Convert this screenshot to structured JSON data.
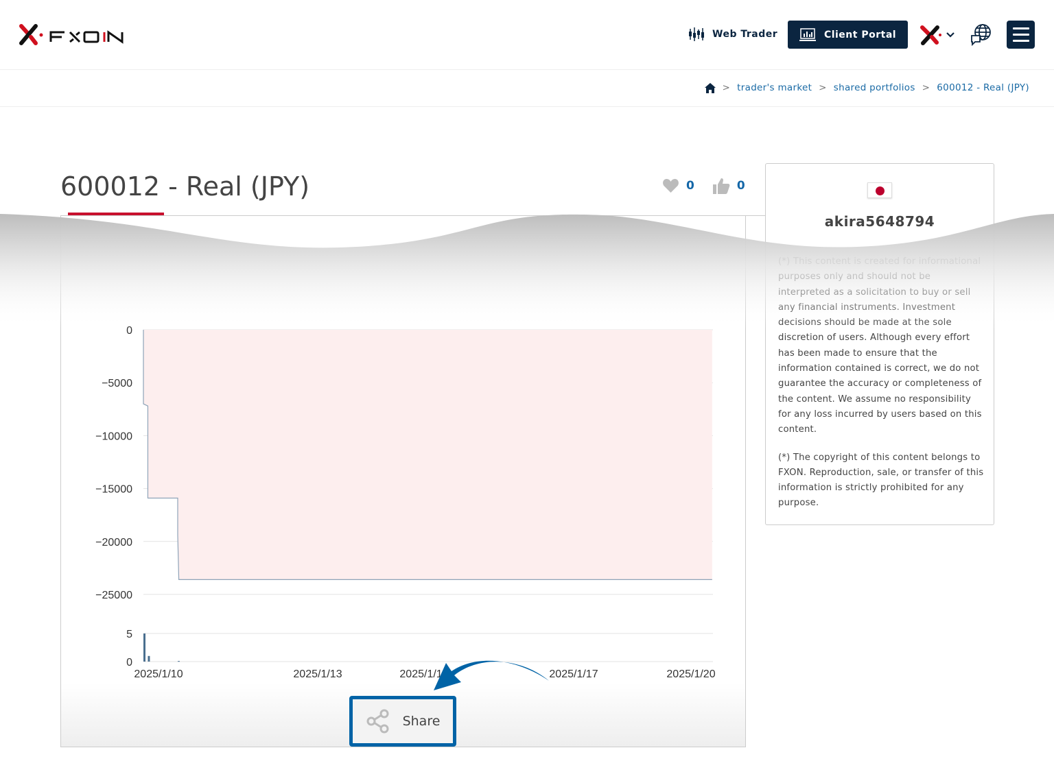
{
  "header": {
    "brand": "FXON",
    "web_trader": "Web Trader",
    "client_portal": "Client Portal",
    "menu_icon": "hamburger-icon",
    "language_icon": "globe-chat-icon"
  },
  "breadcrumb": {
    "home_icon": "home-icon",
    "separator": ">",
    "items": [
      "trader's market",
      "shared portfolios",
      "600012 - Real (JPY)"
    ]
  },
  "page": {
    "title": "600012 - Real (JPY)",
    "favorites": "0",
    "likes": "0"
  },
  "profile": {
    "country": "Japan",
    "username": "akira5648794",
    "disclaimer_1": "(*) This content is created for informational purposes only and should not be interpreted as a solicitation to buy or sell any financial instruments. Investment decisions should be made at the sole discretion of users. Although every effort has been made to ensure that the information contained is correct, we do not guarantee the accuracy or completeness of the content. We assume no responsibility for any loss incurred by users based on this content.",
    "disclaimer_2": "(*) The copyright of this content belongs to FXON. Reproduction, sale, or transfer of this information is strictly prohibited for any purpose."
  },
  "share": {
    "label": "Share",
    "icon": "share-icon"
  },
  "colors": {
    "navy": "#0b2540",
    "accent_red": "#c8102e",
    "link_blue": "#1a6aa5",
    "highlight_blue": "#0063a6",
    "area_fill": "#fdeeee",
    "line": "#8ea3b8"
  },
  "chart_data": {
    "type": "area",
    "x_tick_labels": [
      "2025/1/10",
      "2025/1/13",
      "2025/1/15",
      "2025/1/17",
      "2025/1/20"
    ],
    "y_ticks": [
      0,
      -5000,
      -10000,
      -15000,
      -20000,
      -25000
    ],
    "ylim": [
      -25000,
      0
    ],
    "grid": true,
    "series": [
      {
        "points": [
          {
            "x": "2025/1/10 00:00",
            "y": 0
          },
          {
            "x": "2025/1/10 00:00",
            "y": -7000
          },
          {
            "x": "2025/1/10 02:00",
            "y": -7200
          },
          {
            "x": "2025/1/10 02:00",
            "y": -15900
          },
          {
            "x": "2025/1/10 15:30",
            "y": -15900
          },
          {
            "x": "2025/1/10 15:30",
            "y": -19400
          },
          {
            "x": "2025/1/10 16:00",
            "y": -23600
          },
          {
            "x": "2025/1/20 17:00",
            "y": -23600
          }
        ]
      }
    ],
    "volume": {
      "y_ticks": [
        0,
        5
      ],
      "ylim": [
        0,
        5
      ],
      "bars": [
        {
          "x": "2025/1/10 00:00",
          "y": 5
        },
        {
          "x": "2025/1/10 02:00",
          "y": 1
        },
        {
          "x": "2025/1/10 15:30",
          "y": 0.1
        }
      ]
    }
  }
}
